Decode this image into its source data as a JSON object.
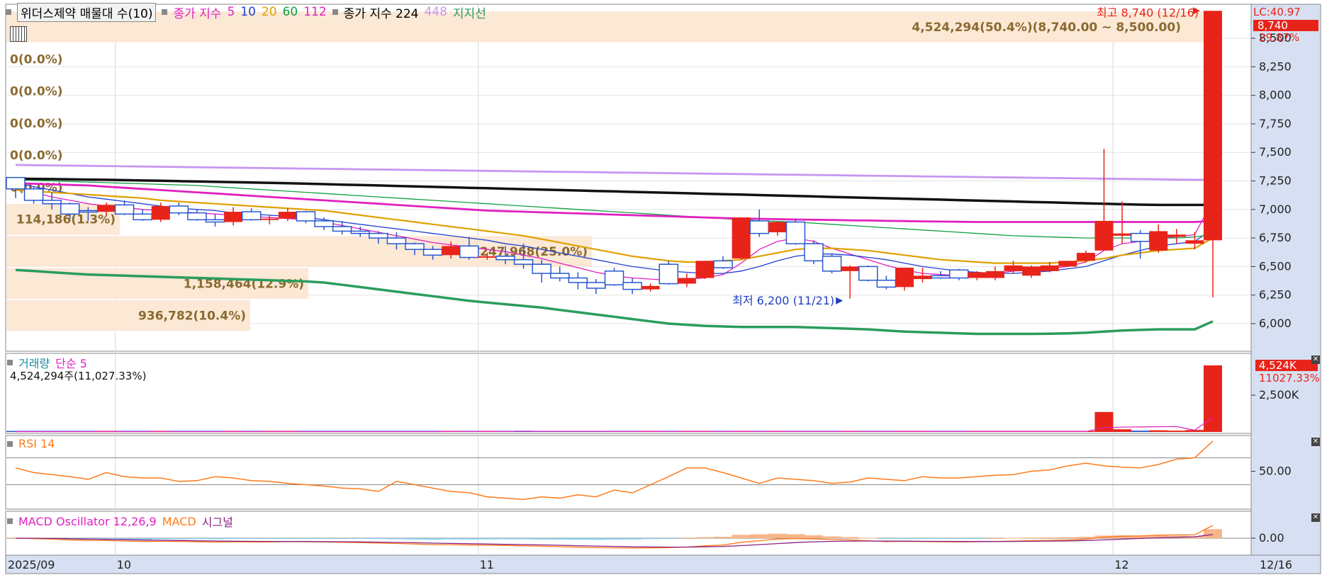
{
  "legend": {
    "title": "위더스제약 매물대 수(10)",
    "ma_label": "종가 지수",
    "ma_periods": [
      {
        "label": "5",
        "color": "#e020c0"
      },
      {
        "label": "10",
        "color": "#2040d0"
      },
      {
        "label": "20",
        "color": "#e0a000"
      },
      {
        "label": "60",
        "color": "#10a040"
      },
      {
        "label": "112",
        "color": "#e020c0"
      }
    ],
    "ma2_label": "종가 지수 224",
    "ma2_extra": "448",
    "support_label": "지지선"
  },
  "price_axis": {
    "ticks": [
      "8,500",
      "8,250",
      "8,000",
      "7,750",
      "7,500",
      "7,250",
      "7,000",
      "6,750",
      "6,500",
      "6,250",
      "6,000"
    ],
    "lc_label": "LC:40.97",
    "last_price": "8,740",
    "last_change": "29.87%"
  },
  "volume_profile": [
    {
      "label": "4,524,294(50.4%)(8,740.00 ~ 8,500.00)"
    },
    {
      "label": "0(0.0%)"
    },
    {
      "label": "0(0.0%)"
    },
    {
      "label": "0(0.0%)"
    },
    {
      "label": "0(0.0%)"
    },
    {
      "label": "0(0.0%)"
    },
    {
      "label": "114,186(1.3%)"
    },
    {
      "label": "2,247,968(25.0%)"
    },
    {
      "label": "1,158,464(12.9%)"
    },
    {
      "label": "936,782(10.4%)"
    }
  ],
  "annotations": {
    "high": "최고 8,740 (12/16)",
    "low": "최저 6,200 (11/21)"
  },
  "volume_panel": {
    "title": "거래량",
    "ma": "단순 5",
    "value_text": "4,524,294주(11,027.33%)",
    "badge": "4,524K",
    "badge2": "11027.33%",
    "tick": "2,500K"
  },
  "rsi_panel": {
    "title": "RSI 14",
    "tick": "50.00"
  },
  "macd_panel": {
    "title": "MACD Oscillator 12,26,9",
    "macd": "MACD",
    "signal": "시그널",
    "tick": "0.00"
  },
  "x_axis": {
    "labels": [
      "2025/09",
      "10",
      "11",
      "12"
    ],
    "last_date": "12/16"
  },
  "chart_data": {
    "type": "candlestick",
    "price_range": [
      5930,
      8740
    ],
    "candles": [
      [
        7280,
        7280,
        7100,
        7180
      ],
      [
        7180,
        7200,
        7050,
        7080
      ],
      [
        7080,
        7150,
        7000,
        7050
      ],
      [
        7050,
        7060,
        6920,
        6960
      ],
      [
        6990,
        7020,
        6900,
        6980
      ],
      [
        6980,
        7060,
        6950,
        7040
      ],
      [
        7040,
        7080,
        6950,
        6960
      ],
      [
        6960,
        7000,
        6900,
        6910
      ],
      [
        6910,
        7060,
        6890,
        7030
      ],
      [
        7030,
        7060,
        6950,
        6970
      ],
      [
        6970,
        7000,
        6900,
        6910
      ],
      [
        6910,
        6960,
        6850,
        6890
      ],
      [
        6890,
        7020,
        6860,
        6980
      ],
      [
        6980,
        7010,
        6900,
        6910
      ],
      [
        6910,
        6950,
        6870,
        6920
      ],
      [
        6920,
        7010,
        6900,
        6980
      ],
      [
        6980,
        6990,
        6880,
        6900
      ],
      [
        6900,
        6930,
        6820,
        6850
      ],
      [
        6850,
        6900,
        6780,
        6810
      ],
      [
        6810,
        6850,
        6760,
        6790
      ],
      [
        6790,
        6810,
        6700,
        6750
      ],
      [
        6750,
        6800,
        6650,
        6700
      ],
      [
        6700,
        6710,
        6600,
        6650
      ],
      [
        6650,
        6680,
        6560,
        6600
      ],
      [
        6600,
        6720,
        6570,
        6680
      ],
      [
        6680,
        6760,
        6560,
        6580
      ],
      [
        6580,
        6620,
        6560,
        6590
      ],
      [
        6590,
        6680,
        6520,
        6560
      ],
      [
        6560,
        6700,
        6480,
        6520
      ],
      [
        6520,
        6560,
        6360,
        6440
      ],
      [
        6440,
        6500,
        6370,
        6400
      ],
      [
        6400,
        6450,
        6300,
        6360
      ],
      [
        6360,
        6390,
        6260,
        6310
      ],
      [
        6460,
        6490,
        6330,
        6340
      ],
      [
        6360,
        6400,
        6260,
        6300
      ],
      [
        6300,
        6350,
        6280,
        6330
      ],
      [
        6520,
        6550,
        6340,
        6350
      ],
      [
        6350,
        6440,
        6320,
        6400
      ],
      [
        6400,
        6550,
        6390,
        6550
      ],
      [
        6550,
        6590,
        6480,
        6490
      ],
      [
        6570,
        6930,
        6560,
        6930
      ],
      [
        6900,
        7000,
        6760,
        6790
      ],
      [
        6800,
        6900,
        6770,
        6890
      ],
      [
        6890,
        6920,
        6690,
        6700
      ],
      [
        6700,
        6730,
        6520,
        6550
      ],
      [
        6590,
        6610,
        6440,
        6460
      ],
      [
        6460,
        6510,
        6220,
        6500
      ],
      [
        6500,
        6510,
        6370,
        6380
      ],
      [
        6380,
        6420,
        6300,
        6320
      ],
      [
        6320,
        6490,
        6290,
        6490
      ],
      [
        6390,
        6490,
        6360,
        6420
      ],
      [
        6420,
        6460,
        6390,
        6400
      ],
      [
        6470,
        6480,
        6380,
        6400
      ],
      [
        6400,
        6460,
        6380,
        6450
      ],
      [
        6400,
        6500,
        6380,
        6460
      ],
      [
        6460,
        6550,
        6440,
        6510
      ],
      [
        6420,
        6510,
        6400,
        6500
      ],
      [
        6460,
        6540,
        6450,
        6510
      ],
      [
        6500,
        6550,
        6500,
        6550
      ],
      [
        6550,
        6640,
        6540,
        6620
      ],
      [
        6640,
        7530,
        6640,
        6900
      ],
      [
        6770,
        7070,
        6700,
        6790
      ],
      [
        6790,
        6820,
        6570,
        6720
      ],
      [
        6640,
        6870,
        6620,
        6810
      ],
      [
        6760,
        6830,
        6700,
        6780
      ],
      [
        6700,
        6800,
        6650,
        6730
      ],
      [
        6730,
        8740,
        6230,
        8740
      ]
    ],
    "volume": [
      5,
      5,
      5,
      5,
      5,
      5,
      5,
      5,
      5,
      5,
      5,
      5,
      5,
      5,
      5,
      5,
      5,
      5,
      5,
      5,
      6,
      6,
      6,
      6,
      6,
      6,
      6,
      6,
      18,
      10,
      6,
      6,
      6,
      6,
      6,
      6,
      6,
      6,
      6,
      6,
      6,
      8,
      6,
      6,
      6,
      6,
      6,
      6,
      6,
      6,
      6,
      6,
      6,
      6,
      6,
      6,
      6,
      6,
      6,
      10,
      300,
      40,
      20,
      25,
      20,
      30,
      1000
    ],
    "rsi": [
      55,
      48,
      45,
      42,
      38,
      48,
      42,
      40,
      40,
      35,
      36,
      42,
      40,
      36,
      35,
      32,
      30,
      28,
      25,
      24,
      20,
      35,
      30,
      25,
      20,
      18,
      12,
      10,
      8,
      12,
      10,
      15,
      12,
      22,
      18,
      30,
      42,
      55,
      55,
      48,
      40,
      32,
      40,
      38,
      36,
      32,
      34,
      40,
      38,
      36,
      42,
      40,
      40,
      42,
      44,
      45,
      50,
      52,
      58,
      62,
      58,
      56,
      55,
      60,
      68,
      70,
      95
    ],
    "ma_series": [
      {
        "name": "5",
        "color": "#e020c0",
        "values": [
          7200,
          7150,
          7110,
          7080,
          7050,
          7030,
          7020,
          7000,
          6990,
          6980,
          6970,
          6960,
          6950,
          6940,
          6930,
          6920,
          6910,
          6890,
          6860,
          6830,
          6800,
          6770,
          6740,
          6710,
          6690,
          6670,
          6650,
          6630,
          6600,
          6570,
          6530,
          6490,
          6450,
          6420,
          6400,
          6390,
          6380,
          6390,
          6400,
          6430,
          6530,
          6650,
          6720,
          6750,
          6720,
          6660,
          6610,
          6560,
          6510,
          6470,
          6440,
          6430,
          6420,
          6430,
          6440,
          6460,
          6470,
          6480,
          6500,
          6540,
          6640,
          6700,
          6720,
          6750,
          6760,
          6780,
          7080
        ]
      },
      {
        "name": "10",
        "color": "#2040d0",
        "values": [
          7230,
          7200,
          7170,
          7140,
          7110,
          7090,
          7070,
          7050,
          7030,
          7010,
          7000,
          6990,
          6970,
          6960,
          6950,
          6940,
          6930,
          6910,
          6890,
          6870,
          6850,
          6830,
          6810,
          6790,
          6770,
          6750,
          6730,
          6700,
          6680,
          6650,
          6620,
          6590,
          6560,
          6530,
          6500,
          6480,
          6460,
          6450,
          6440,
          6440,
          6460,
          6500,
          6550,
          6590,
          6610,
          6610,
          6600,
          6580,
          6560,
          6530,
          6500,
          6480,
          6460,
          6450,
          6440,
          6440,
          6450,
          6460,
          6480,
          6500,
          6550,
          6600,
          6640,
          6680,
          6700,
          6720,
          6830
        ]
      },
      {
        "name": "20",
        "color": "#e0a000",
        "values": [
          7170,
          7160,
          7150,
          7140,
          7130,
          7120,
          7110,
          7100,
          7080,
          7070,
          7060,
          7050,
          7040,
          7030,
          7020,
          7010,
          7000,
          6990,
          6970,
          6950,
          6930,
          6910,
          6890,
          6870,
          6850,
          6830,
          6810,
          6790,
          6770,
          6740,
          6710,
          6680,
          6650,
          6620,
          6590,
          6570,
          6550,
          6540,
          6540,
          6550,
          6560,
          6590,
          6620,
          6650,
          6660,
          6660,
          6650,
          6640,
          6620,
          6600,
          6580,
          6560,
          6550,
          6540,
          6530,
          6530,
          6530,
          6530,
          6540,
          6550,
          6570,
          6600,
          6620,
          6640,
          6650,
          6660,
          6750
        ]
      },
      {
        "name": "60",
        "color": "#10a040",
        "values": [
          7260,
          7255,
          7250,
          7245,
          7240,
          7235,
          7230,
          7225,
          7220,
          7215,
          7210,
          7200,
          7190,
          7180,
          7170,
          7160,
          7150,
          7140,
          7130,
          7120,
          7110,
          7100,
          7090,
          7080,
          7070,
          7060,
          7050,
          7040,
          7030,
          7020,
          7010,
          7000,
          6990,
          6980,
          6970,
          6960,
          6950,
          6940,
          6930,
          6920,
          6910,
          6900,
          6895,
          6890,
          6880,
          6870,
          6860,
          6850,
          6840,
          6830,
          6820,
          6810,
          6800,
          6790,
          6780,
          6770,
          6765,
          6760,
          6755,
          6750,
          6750,
          6750,
          6750,
          6750,
          6750,
          6760,
          6780
        ]
      },
      {
        "name": "112",
        "color": "#e020c0",
        "values": [
          7230,
          7225,
          7220,
          7215,
          7210,
          7200,
          7190,
          7180,
          7170,
          7160,
          7150,
          7140,
          7130,
          7120,
          7110,
          7100,
          7090,
          7080,
          7070,
          7060,
          7050,
          7040,
          7030,
          7020,
          7010,
          7000,
          6990,
          6985,
          6980,
          6975,
          6970,
          6965,
          6960,
          6955,
          6950,
          6945,
          6940,
          6935,
          6930,
          6925,
          6920,
          6918,
          6915,
          6912,
          6910,
          6908,
          6905,
          6903,
          6900,
          6898,
          6896,
          6894,
          6892,
          6890,
          6890,
          6890,
          6890,
          6890,
          6890,
          6890,
          6890,
          6890,
          6890,
          6890,
          6890,
          6890,
          6900
        ]
      },
      {
        "name": "224",
        "color": "#111111",
        "values": [
          7270,
          7268,
          7266,
          7264,
          7262,
          7260,
          7257,
          7254,
          7251,
          7248,
          7245,
          7242,
          7239,
          7236,
          7233,
          7230,
          7226,
          7222,
          7218,
          7214,
          7210,
          7206,
          7202,
          7198,
          7194,
          7190,
          7186,
          7182,
          7178,
          7174,
          7170,
          7166,
          7162,
          7158,
          7154,
          7150,
          7146,
          7142,
          7138,
          7134,
          7130,
          7126,
          7122,
          7118,
          7114,
          7110,
          7106,
          7102,
          7098,
          7094,
          7090,
          7086,
          7082,
          7078,
          7074,
          7070,
          7066,
          7062,
          7058,
          7054,
          7050,
          7046,
          7042,
          7040,
          7040,
          7040,
          7040
        ]
      },
      {
        "name": "448",
        "color": "#c896f0",
        "values": [
          7390,
          7388,
          7386,
          7384,
          7382,
          7380,
          7378,
          7376,
          7374,
          7372,
          7370,
          7368,
          7366,
          7364,
          7362,
          7360,
          7358,
          7356,
          7354,
          7352,
          7350,
          7348,
          7346,
          7344,
          7342,
          7340,
          7338,
          7336,
          7334,
          7332,
          7330,
          7328,
          7326,
          7324,
          7322,
          7320,
          7318,
          7316,
          7314,
          7312,
          7310,
          7308,
          7306,
          7304,
          7302,
          7300,
          7298,
          7296,
          7294,
          7292,
          7290,
          7288,
          7286,
          7284,
          7282,
          7280,
          7278,
          7276,
          7274,
          7272,
          7270,
          7268,
          7266,
          7264,
          7262,
          7260,
          7260
        ]
      },
      {
        "name": "지지선",
        "color": "#2a9d5c",
        "values": [
          6470,
          6460,
          6450,
          6440,
          6430,
          6425,
          6420,
          6415,
          6410,
          6405,
          6400,
          6395,
          6390,
          6385,
          6380,
          6375,
          6370,
          6360,
          6340,
          6320,
          6300,
          6280,
          6260,
          6240,
          6220,
          6200,
          6185,
          6170,
          6155,
          6140,
          6120,
          6100,
          6080,
          6060,
          6040,
          6020,
          6000,
          5990,
          5980,
          5975,
          5970,
          5970,
          5970,
          5970,
          5965,
          5960,
          5955,
          5950,
          5940,
          5930,
          5925,
          5920,
          5915,
          5910,
          5910,
          5910,
          5910,
          5912,
          5915,
          5920,
          5930,
          5940,
          5945,
          5950,
          5950,
          5950,
          6020
        ]
      }
    ]
  }
}
